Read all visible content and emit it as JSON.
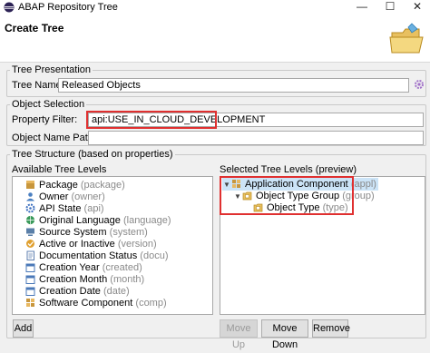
{
  "window": {
    "title": "ABAP Repository Tree",
    "minimize": "—",
    "maximize": "☐",
    "close": "✕"
  },
  "header": {
    "title": "Create Tree"
  },
  "tree_presentation": {
    "legend": "Tree Presentation",
    "tree_name_label": "Tree Name: *",
    "tree_name_value": "Released Objects"
  },
  "object_selection": {
    "legend": "Object Selection",
    "property_filter_label": "Property Filter:",
    "property_filter_value": "api:USE_IN_CLOUD_DEVELOPMENT",
    "object_name_pattern_label": "Object Name Pattern:",
    "object_name_pattern_value": ""
  },
  "tree_structure": {
    "legend": "Tree Structure (based on properties)",
    "available_label": "Available Tree Levels",
    "selected_label": "Selected Tree Levels (preview)",
    "available_levels": [
      {
        "name": "Package",
        "key": "(package)",
        "icon": "package-icon",
        "color": "#c8963c"
      },
      {
        "name": "Owner",
        "key": "(owner)",
        "icon": "person-icon",
        "color": "#4a7fc1"
      },
      {
        "name": "API State",
        "key": "(api)",
        "icon": "gear-icon",
        "color": "#3c6fbf"
      },
      {
        "name": "Original Language",
        "key": "(language)",
        "icon": "globe-icon",
        "color": "#3a9a5a"
      },
      {
        "name": "Source System",
        "key": "(system)",
        "icon": "system-icon",
        "color": "#5a7fa8"
      },
      {
        "name": "Active or Inactive",
        "key": "(version)",
        "icon": "active-icon",
        "color": "#e0a030"
      },
      {
        "name": "Documentation Status",
        "key": "(docu)",
        "icon": "document-icon",
        "color": "#6080b0"
      },
      {
        "name": "Creation Year",
        "key": "(created)",
        "icon": "calendar-icon",
        "color": "#4a78b8"
      },
      {
        "name": "Creation Month",
        "key": "(month)",
        "icon": "calendar-icon",
        "color": "#4a78b8"
      },
      {
        "name": "Creation Date",
        "key": "(date)",
        "icon": "calendar-icon",
        "color": "#4a78b8"
      },
      {
        "name": "Software Component",
        "key": "(comp)",
        "icon": "component-icon",
        "color": "#c8963c"
      }
    ],
    "selected_levels": [
      {
        "name": "Application Component",
        "key": "(appl)",
        "icon": "component-icon"
      },
      {
        "name": "Object Type Group",
        "key": "(group)",
        "icon": "folder-icon"
      },
      {
        "name": "Object Type",
        "key": "(type)",
        "icon": "folder-icon"
      }
    ]
  },
  "buttons": {
    "add": "Add",
    "move_up": "Move Up",
    "move_down": "Move Down",
    "remove": "Remove"
  },
  "colors": {
    "highlight_border": "#e03030",
    "selection": "#cce4f7",
    "hint_text": "#8a8a8a"
  }
}
